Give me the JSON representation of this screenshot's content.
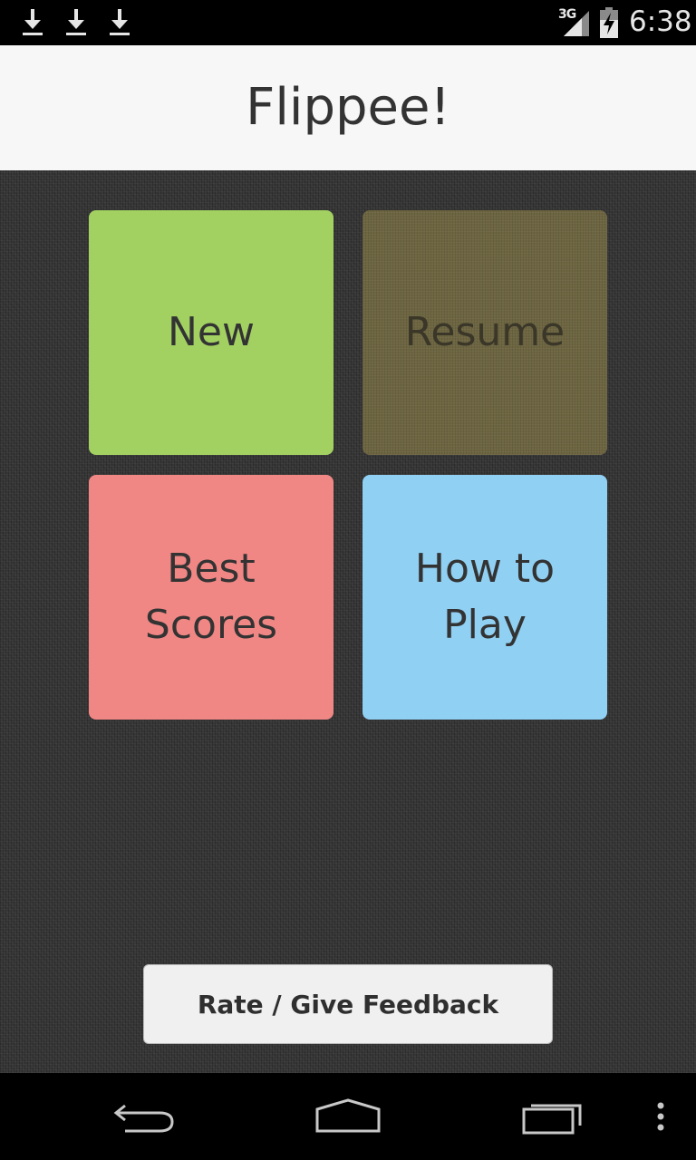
{
  "status_bar": {
    "time": "6:38",
    "network": "3G",
    "icons": [
      "download-icon",
      "download-icon",
      "download-icon",
      "signal-icon",
      "battery-charging-icon"
    ]
  },
  "app_bar": {
    "title": "Flippee!"
  },
  "menu": {
    "new_label": "New",
    "resume_label": "Resume",
    "best_scores_label": "Best Scores",
    "how_to_play_label": "How to Play"
  },
  "feedback": {
    "label": "Rate / Give Feedback"
  },
  "nav_bar": {
    "icons": [
      "back-icon",
      "home-icon",
      "recents-icon",
      "overflow-menu-icon"
    ]
  },
  "colors": {
    "new_tile": "#a2d162",
    "resume_tile": "#6d6541",
    "best_scores_tile": "#f08785",
    "how_to_play_tile": "#90d0f3",
    "background": "#353535",
    "app_bar": "#f7f7f7"
  }
}
